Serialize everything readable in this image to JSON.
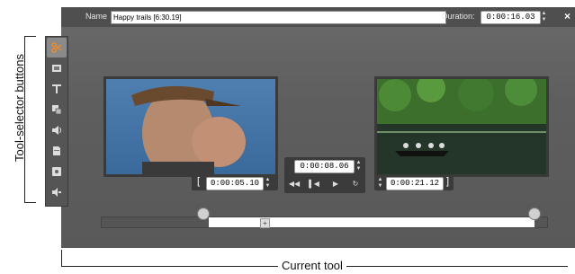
{
  "annotations": {
    "side_label": "Tool-selector buttons",
    "bottom_label": "Current tool"
  },
  "header": {
    "name_label": "Name",
    "name_value": "Happy trails [6:30.19]",
    "duration_label": "Duration:",
    "duration_value": "0:00:16.03",
    "close": "×"
  },
  "toolbar": {
    "tools": [
      {
        "name": "scissors-icon",
        "active": true
      },
      {
        "name": "clip-properties-icon",
        "active": false
      },
      {
        "name": "text-icon",
        "active": false
      },
      {
        "name": "effects-icon",
        "active": false
      },
      {
        "name": "audio-icon",
        "active": false
      },
      {
        "name": "file-icon",
        "active": false
      },
      {
        "name": "disc-icon",
        "active": false
      },
      {
        "name": "speaker-icon",
        "active": false
      }
    ]
  },
  "trim": {
    "in_point": "0:00:05.10",
    "out_point": "0:00:21.12",
    "position": "0:00:08.06"
  },
  "colors": {
    "accent_tool": "#f08a2a",
    "panel_bg": "#5f5f5f"
  }
}
